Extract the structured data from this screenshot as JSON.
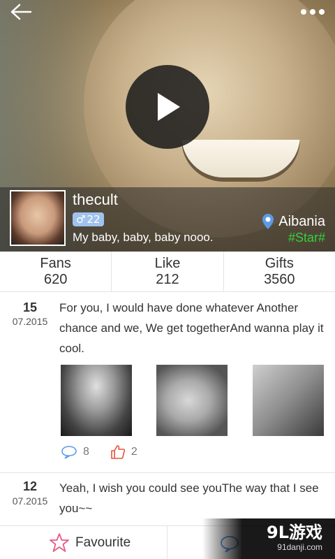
{
  "header": {
    "back_icon": "arrow-left-icon",
    "more_icon": "ellipsis-icon",
    "play_icon": "play-icon"
  },
  "profile": {
    "username": "thecult",
    "gender_symbol": "♂",
    "age": "22",
    "motto": "My baby, baby, baby nooo.",
    "location": "Aibania",
    "tag": "#Star#"
  },
  "stats": [
    {
      "label": "Fans",
      "value": "620"
    },
    {
      "label": "Like",
      "value": "212"
    },
    {
      "label": "Gifts",
      "value": "3560"
    }
  ],
  "posts": [
    {
      "day": "15",
      "year_month": "07.2015",
      "text": "For you, I would have done whatever Another chance and we, We get togetherAnd wanna play it cool.",
      "comments": "8",
      "likes": "2"
    },
    {
      "day": "12",
      "year_month": "07.2015",
      "text": "Yeah, I wish you could see youThe way that I see you~~"
    }
  ],
  "bottom_bar": {
    "favourite_label": "Favourite"
  },
  "watermark": {
    "line1": "9L游戏",
    "line2": "91danji.com"
  },
  "colors": {
    "accent_green": "#36d13a",
    "badge_blue": "#9fc3ee",
    "like_red": "#e5533a",
    "comment_blue": "#5b9be6",
    "star_pink": "#e85a86"
  }
}
